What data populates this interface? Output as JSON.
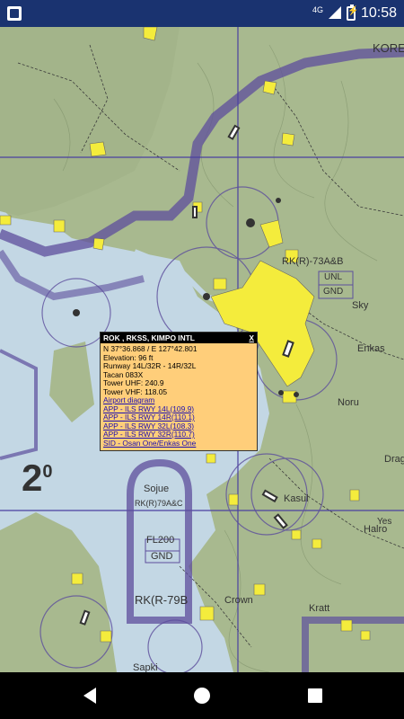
{
  "status_bar": {
    "network": "4G",
    "time": "10:58"
  },
  "map": {
    "labels": {
      "korea": "KORE",
      "rkr73": "RK(R)-73A&B",
      "unl": "UNL",
      "gnd1": "GND",
      "sky": "Sky",
      "enkas": "Enkas",
      "noru": "Noru",
      "drag": "Drag",
      "kasul": "Kasul",
      "sojue": "Sojue",
      "rkr79": "RK(R)79A&C",
      "fl200": "FL200",
      "gnd2": "GND",
      "rkr79b": "RK(R-79B",
      "halro": "Halro",
      "kimpo_num": "2",
      "kimpo_deg": "0",
      "crown": "Crown",
      "kratt": "Kratt",
      "sapki": "Sapki",
      "yes": "Yes"
    },
    "colors": {
      "sea": "#c3d7e4",
      "land": "#a7b98e",
      "airspace": "#5d4e9c",
      "yellow": "#f9f14a"
    }
  },
  "popup": {
    "title": "ROK , RKSS, KIMPO INTL",
    "close": "X",
    "coords": "N 37°36.868 / E 127°42.801",
    "elevation": "Elevation: 96 ft",
    "runway": "Runway 14L/32R - 14R/32L",
    "tacan": "Tacan 083X",
    "tower_uhf": "Tower UHF: 240.9",
    "tower_vhf": "Tower VHF: 118.05",
    "links": [
      "Airport diagram",
      "APP - ILS RWY 14L(109.9)",
      "APP - ILS RWY 14R(110.1)",
      "APP - ILS RWY 32L(108.3)",
      "APP - ILS RWY 32R(110.7)",
      "SID - Osan One/Enkas One"
    ]
  }
}
